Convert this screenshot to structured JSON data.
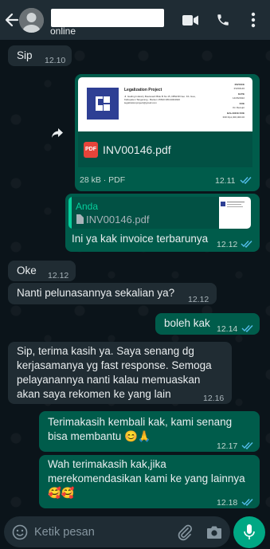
{
  "header": {
    "status": "online",
    "icons": [
      "back-arrow-icon",
      "video-call-icon",
      "phone-call-icon",
      "more-options-icon"
    ]
  },
  "messages": [
    {
      "id": "m1",
      "direction": "in",
      "text": "Sip",
      "time": "12.10"
    },
    {
      "id": "m2",
      "direction": "out",
      "type": "document",
      "file_name": "INV00146.pdf",
      "file_meta": "28 kB · PDF",
      "time": "12.11",
      "read": true,
      "preview": {
        "company": "Legalization Project",
        "address": "Jl. Gading Industry Boulevard Blok B No 15, DBW18 Neo. Kb. Gua, Kabupaten Tangerang - Banten 15810 08134004920 legalizationproject@gmail.com",
        "invoice_label": "INVOICE",
        "invoice_no": "INV00146",
        "date_label": "DATE",
        "date": "14/06/2022",
        "due_label": "DUE",
        "due": "On Receipt",
        "balance_label": "BALANCE DUE",
        "balance": "IDR Rp1,300,000.00"
      }
    },
    {
      "id": "m3",
      "direction": "out",
      "type": "reply",
      "quote_author": "Anda",
      "quote_text": "INV00146.pdf",
      "quote_icon": "document-icon",
      "text": "Ini ya kak invoice terbarunya",
      "time": "12.12",
      "read": true
    },
    {
      "id": "m4",
      "direction": "in",
      "text": "Oke",
      "time": "12.12"
    },
    {
      "id": "m5",
      "direction": "in",
      "text": "Nanti pelunasannya sekalian ya?",
      "time": "12.12"
    },
    {
      "id": "m6",
      "direction": "out",
      "text": "boleh kak",
      "time": "12.14",
      "read": true
    },
    {
      "id": "m7",
      "direction": "in",
      "lines": [
        "Sip, terima kasih ya. Saya senang dg",
        "kerjasamanya yg fast response. Semoga",
        "pelayanannya nanti kalau memuaskan",
        "akan saya rekomen ke yang lain"
      ],
      "time": "12.16"
    },
    {
      "id": "m8",
      "direction": "out",
      "lines": [
        "Terimakasih kembali kak, kami senang",
        "bisa membantu 😊🙏"
      ],
      "time": "12.17",
      "read": true
    },
    {
      "id": "m9",
      "direction": "out",
      "lines": [
        "Wah terimakasih kak,jika",
        "merekomendasikan kami ke yang lainnya",
        "🥰🥰"
      ],
      "time": "12.18",
      "read": true
    }
  ],
  "input": {
    "placeholder": "Ketik pesan",
    "icons": [
      "emoji-icon",
      "attach-icon",
      "camera-icon",
      "mic-icon"
    ]
  },
  "colors": {
    "background": "#0b141a",
    "header": "#1f2c34",
    "incoming_bubble": "#202c33",
    "outgoing_bubble": "#005c4b",
    "read_ticks": "#53bdeb",
    "accent": "#00a884"
  }
}
